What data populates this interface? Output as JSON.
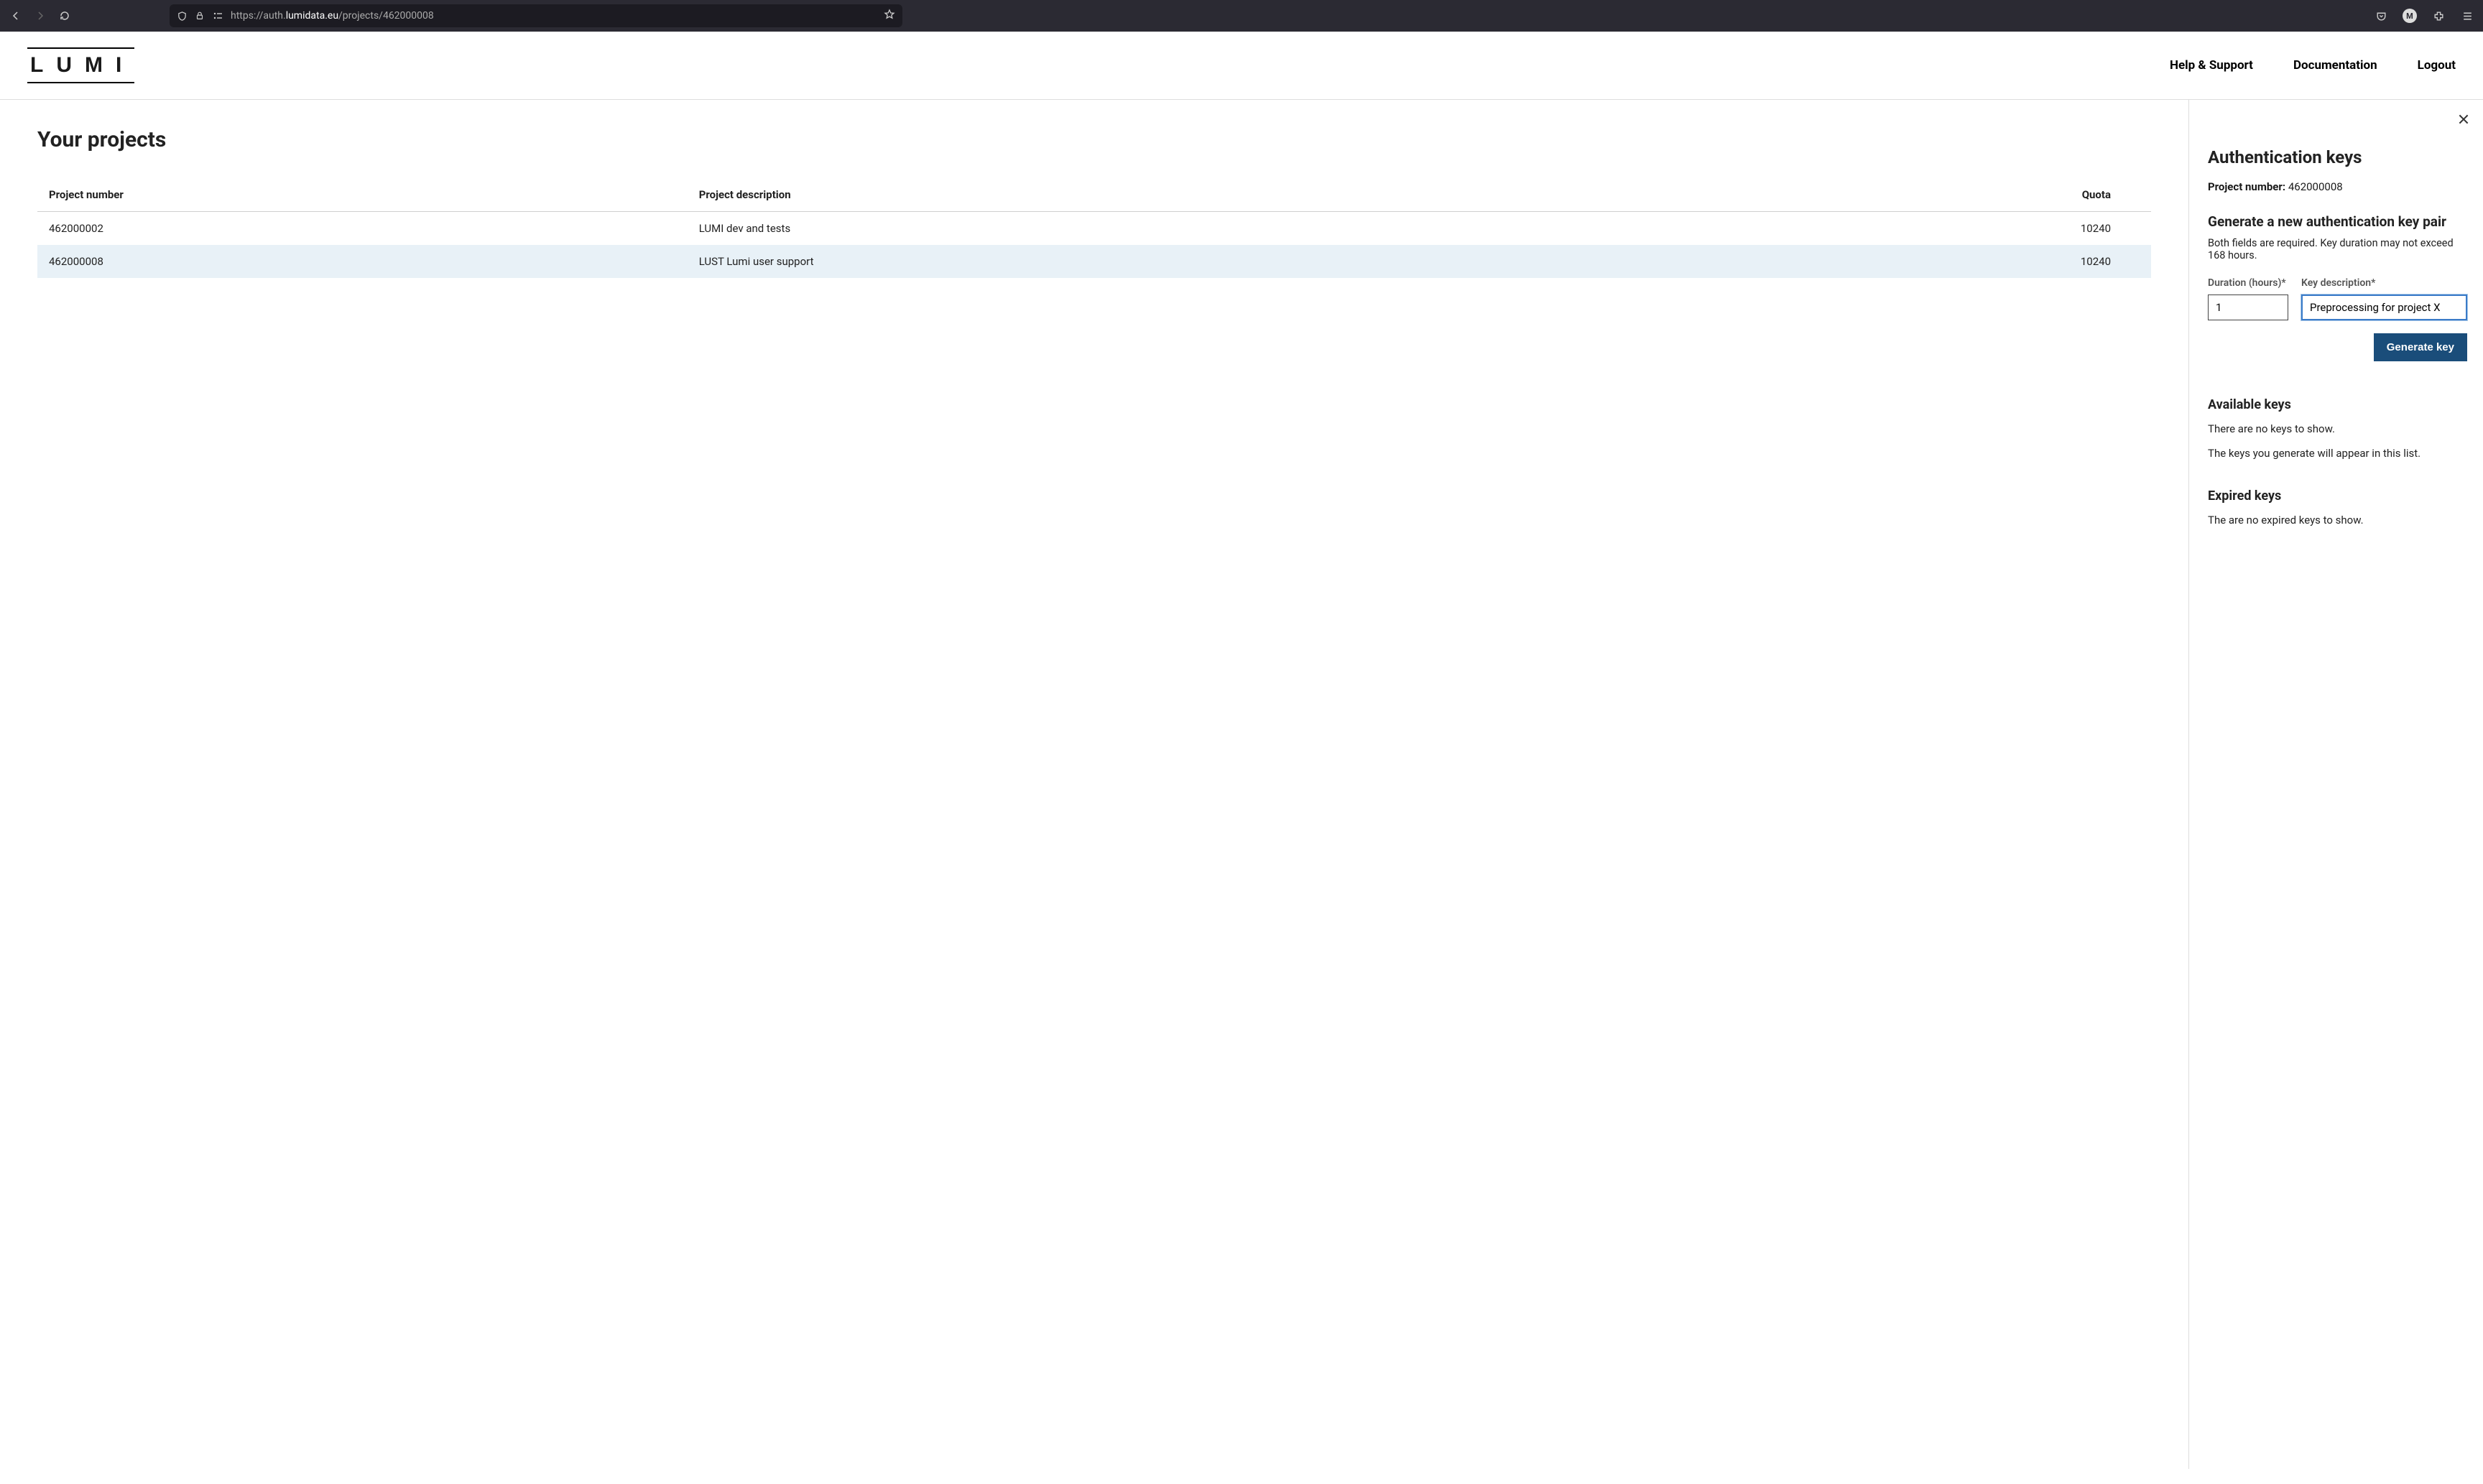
{
  "browser": {
    "url_pre": "https://auth.",
    "url_domain": "lumidata.eu",
    "url_path": "/projects/462000008",
    "avatar_letter": "M"
  },
  "header": {
    "logo": "LUMI",
    "nav": {
      "help": "Help & Support",
      "docs": "Documentation",
      "logout": "Logout"
    }
  },
  "main": {
    "title": "Your projects",
    "columns": {
      "number": "Project number",
      "desc": "Project description",
      "quota": "Quota"
    },
    "rows": [
      {
        "number": "462000002",
        "desc": "LUMI dev and tests",
        "quota": "10240",
        "selected": false
      },
      {
        "number": "462000008",
        "desc": "LUST Lumi user support",
        "quota": "10240",
        "selected": true
      }
    ]
  },
  "panel": {
    "title": "Authentication keys",
    "proj_label": "Project number:",
    "proj_value": "462000008",
    "gen_heading": "Generate a new authentication key pair",
    "gen_note": "Both fields are required. Key duration may not exceed 168 hours.",
    "duration_label": "Duration (hours)*",
    "duration_value": "1",
    "desc_label": "Key description*",
    "desc_value": "Preprocessing for project X",
    "gen_button": "Generate key",
    "avail_heading": "Available keys",
    "avail_empty": "There are no keys to show.",
    "avail_note": "The keys you generate will appear in this list.",
    "exp_heading": "Expired keys",
    "exp_empty": "The are no expired keys to show."
  }
}
